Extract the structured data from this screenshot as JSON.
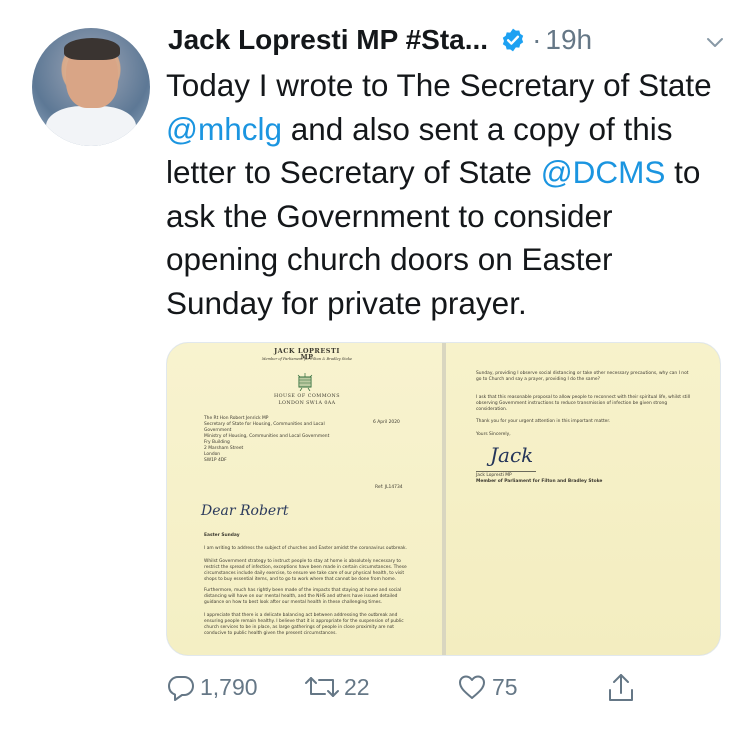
{
  "tweet": {
    "author_name": "Jack Lopresti MP #Sta...",
    "separator": "·",
    "time": "19h",
    "text_parts": {
      "p1": "Today I wrote to The Secretary of State ",
      "mention1": "@mhclg",
      "p2": " and also sent a copy of this letter to Secretary of State ",
      "mention2": "@DCMS",
      "p3": " to ask the Government to consider opening church doors on Easter Sunday for private prayer."
    }
  },
  "letter": {
    "page1": {
      "sender": "JACK LOPRESTI MP",
      "sender_sub": "Member of Parliament for Filton & Bradley Stoke",
      "house": "HOUSE OF COMMONS",
      "city": "LONDON SW1A 0AA",
      "address_lines": [
        "The Rt Hon Robert Jenrick MP",
        "Secretary of State for Housing, Communities and Local Government",
        "Ministry of Housing, Communities and Local Government",
        "Fry Building",
        "2 Marsham Street",
        "London",
        "SW1P 4DF"
      ],
      "date": "6 April 2020",
      "ref": "Ref: JL14734",
      "salutation": "Dear Robert",
      "subject": "Easter Sunday",
      "paragraphs": [
        "I am writing to address the subject of churches and Easter amidst the coronavirus outbreak.",
        "Whilst Government strategy to instruct people to stay at home is absolutely necessary to restrict the spread of infection, exceptions have been made in certain circumstances. These circumstances include daily exercise, to ensure we take care of our physical health, to visit shops to buy essential items, and to go to work where that cannot be done from home.",
        "Furthermore, much has rightly been made of the impacts that staying at home and social distancing will have on our mental health, and the NHS and others have issued detailed guidance on how to best look after our mental health in these challenging times.",
        "I appreciate that there is a delicate balancing act between addressing the outbreak and ensuring people remain healthy. I believe that it is appropriate for the suspension of public church services to be in place, as large gatherings of people in close proximity are not conducive to public health given the present circumstances."
      ]
    },
    "page2": {
      "paragraphs": [
        "Sunday, providing I observe social distancing or take other necessary precautions, why can I not go to Church and say a prayer, providing I do the same?",
        "I ask that this reasonable proposal to allow people to reconnect with their spiritual life, whilst still observing Government instructions to reduce transmission of infection be given strong consideration.",
        "Thank you for your urgent attention in this important matter.",
        "Yours Sincerely,"
      ],
      "signature": "Jack",
      "signer": "Jack Lopresti MP",
      "signer_title": "Member of Parliament for Filton and Bradley Stoke"
    }
  },
  "actions": {
    "replies": "1,790",
    "retweets": "22",
    "likes": "75"
  },
  "colors": {
    "accent": "#1b95e0",
    "muted": "#657786",
    "verified": "#1da1f2"
  },
  "icons": {
    "reply": "reply-icon",
    "retweet": "retweet-icon",
    "like": "heart-icon",
    "share": "share-icon",
    "verified": "verified-badge-icon",
    "more": "chevron-down-icon"
  }
}
